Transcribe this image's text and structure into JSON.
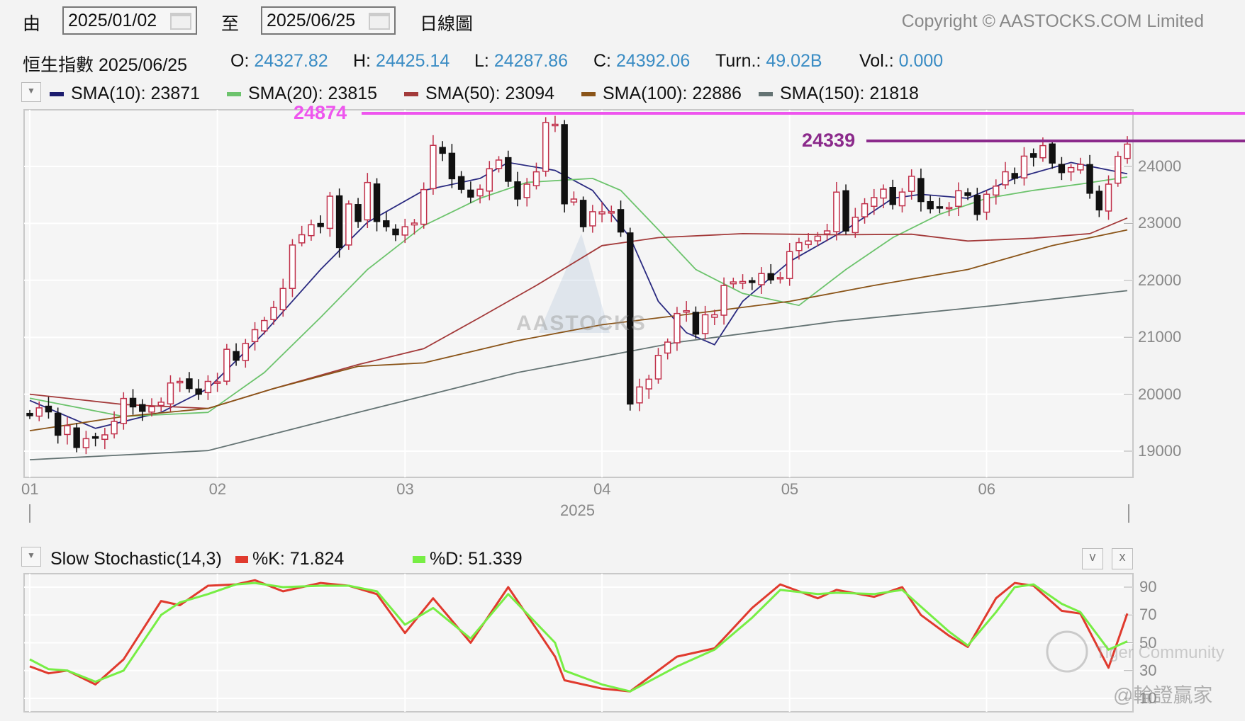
{
  "toolbar": {
    "from_label": "由",
    "from_date": "2025/01/02",
    "to_label": "至",
    "to_date": "2025/06/25",
    "period": "日線圖",
    "copyright": "Copyright © AASTOCKS.COM Limited"
  },
  "quote": {
    "name": "恒生指數",
    "date": "2025/06/25",
    "open_label": "O:",
    "open": "24327.82",
    "high_label": "H:",
    "high": "24425.14",
    "low_label": "L:",
    "low": "24287.86",
    "close_label": "C:",
    "close": "24392.06",
    "turn_label": "Turn.:",
    "turn": "49.02B",
    "vol_label": "Vol.:",
    "vol": "0.000"
  },
  "legend": [
    {
      "label": "SMA(10): 23871",
      "color": "#1c1c6e"
    },
    {
      "label": "SMA(20): 23815",
      "color": "#6cc36c"
    },
    {
      "label": "SMA(50): 23094",
      "color": "#a33a3a"
    },
    {
      "label": "SMA(100): 22886",
      "color": "#8a5418"
    },
    {
      "label": "SMA(150): 21818",
      "color": "#647373"
    }
  ],
  "stoch": {
    "title": "Slow Stochastic(14,3)",
    "k_label": "%K: 71.824",
    "d_label": "%D: 51.339",
    "k_color": "#e03a2e",
    "d_color": "#77ee44",
    "collapse_btn": "v",
    "close_btn": "x"
  },
  "watermarks": {
    "center": "AASTOCKS",
    "tiger": "Tiger Community",
    "handle": "@輪證贏家"
  },
  "chart_data": [
    {
      "type": "candlestick",
      "title": "恒生指數 日線圖",
      "ylim": [
        18700,
        24900
      ],
      "yticks": [
        19000,
        20000,
        21000,
        22000,
        23000,
        24000
      ],
      "xticks": [
        {
          "label": "01",
          "index": 0
        },
        {
          "label": "02",
          "index": 20
        },
        {
          "label": "03",
          "index": 40
        },
        {
          "label": "04",
          "index": 61
        },
        {
          "label": "05",
          "index": 81
        },
        {
          "label": "06",
          "index": 102
        }
      ],
      "xlabel": "2025",
      "hlines": [
        {
          "label": "24874",
          "value": 24874,
          "color": "#ee55ee"
        },
        {
          "label": "24339",
          "value": 24339,
          "color": "#8b2a8b"
        }
      ],
      "close": [
        19623,
        19760,
        19690,
        19280,
        19447,
        19065,
        19219,
        19227,
        19286,
        19522,
        19925,
        19778,
        19700,
        19780,
        19860,
        20197,
        20225,
        20100,
        20000,
        20225,
        20217,
        20789,
        20597,
        20891,
        21133,
        21294,
        21521,
        21857,
        22620,
        22800,
        22976,
        22944,
        23477,
        22577,
        23341,
        23035,
        23718,
        23034,
        22941,
        22800,
        22941,
        23006,
        23594,
        24370,
        24231,
        23784,
        23600,
        23462,
        23600,
        23959,
        24112,
        23740,
        23428,
        23689,
        23905,
        24771,
        24740,
        23344,
        23427,
        22941,
        23205,
        23202,
        23206,
        22849,
        19828,
        20127,
        20264,
        20682,
        20915,
        21417,
        21466,
        21056,
        21395,
        21395,
        21909,
        21972,
        21980,
        21962,
        22119,
        22008,
        22050,
        22504,
        22662,
        22691,
        22775,
        22868,
        23549,
        22867,
        23108,
        23345,
        23453,
        23601,
        23333,
        23550,
        23827,
        23384,
        23258,
        23289,
        23282,
        23573,
        23490,
        23158,
        23512,
        23654,
        23906,
        23792,
        24181,
        24162,
        24366,
        24060,
        23892,
        23980,
        24036,
        23530,
        23237,
        23689,
        24177,
        24392
      ],
      "sma": [
        {
          "name": "SMA(10)",
          "color": "#2a2a80",
          "points": [
            [
              0,
              19890
            ],
            [
              7,
              19400
            ],
            [
              14,
              19680
            ],
            [
              19,
              20100
            ],
            [
              25,
              21080
            ],
            [
              31,
              22190
            ],
            [
              36,
              23020
            ],
            [
              42,
              23580
            ],
            [
              48,
              23790
            ],
            [
              51,
              24070
            ],
            [
              56,
              23930
            ],
            [
              60,
              23580
            ],
            [
              64,
              22750
            ],
            [
              67,
              21630
            ],
            [
              70,
              21080
            ],
            [
              73,
              20870
            ],
            [
              76,
              21630
            ],
            [
              81,
              22330
            ],
            [
              87,
              22890
            ],
            [
              92,
              23440
            ],
            [
              95,
              23510
            ],
            [
              100,
              23440
            ],
            [
              105,
              23790
            ],
            [
              111,
              24070
            ],
            [
              117,
              23871
            ]
          ]
        },
        {
          "name": "SMA(20)",
          "color": "#6cc36c",
          "points": [
            [
              0,
              19930
            ],
            [
              10,
              19610
            ],
            [
              19,
              19680
            ],
            [
              25,
              20380
            ],
            [
              31,
              21350
            ],
            [
              36,
              22190
            ],
            [
              42,
              22960
            ],
            [
              48,
              23440
            ],
            [
              53,
              23720
            ],
            [
              60,
              23790
            ],
            [
              63,
              23580
            ],
            [
              67,
              22890
            ],
            [
              71,
              22190
            ],
            [
              76,
              21770
            ],
            [
              82,
              21560
            ],
            [
              87,
              22190
            ],
            [
              92,
              22750
            ],
            [
              97,
              23160
            ],
            [
              102,
              23440
            ],
            [
              107,
              23580
            ],
            [
              112,
              23690
            ],
            [
              117,
              23815
            ]
          ]
        },
        {
          "name": "SMA(50)",
          "color": "#a33a3a",
          "points": [
            [
              0,
              20000
            ],
            [
              10,
              19820
            ],
            [
              19,
              19750
            ],
            [
              26,
              20100
            ],
            [
              35,
              20520
            ],
            [
              42,
              20800
            ],
            [
              48,
              21350
            ],
            [
              54,
              21910
            ],
            [
              61,
              22610
            ],
            [
              67,
              22750
            ],
            [
              76,
              22820
            ],
            [
              86,
              22800
            ],
            [
              94,
              22810
            ],
            [
              100,
              22690
            ],
            [
              107,
              22740
            ],
            [
              113,
              22820
            ],
            [
              117,
              23094
            ]
          ]
        },
        {
          "name": "SMA(100)",
          "color": "#8a5418",
          "points": [
            [
              0,
              19360
            ],
            [
              10,
              19610
            ],
            [
              19,
              19750
            ],
            [
              26,
              20100
            ],
            [
              35,
              20490
            ],
            [
              42,
              20550
            ],
            [
              52,
              20940
            ],
            [
              61,
              21220
            ],
            [
              71,
              21420
            ],
            [
              81,
              21630
            ],
            [
              90,
              21910
            ],
            [
              100,
              22190
            ],
            [
              109,
              22610
            ],
            [
              117,
              22886
            ]
          ]
        },
        {
          "name": "SMA(150)",
          "color": "#647373",
          "points": [
            [
              0,
              18850
            ],
            [
              19,
              19010
            ],
            [
              35,
              19680
            ],
            [
              52,
              20380
            ],
            [
              69,
              20910
            ],
            [
              86,
              21280
            ],
            [
              103,
              21560
            ],
            [
              117,
              21818
            ]
          ]
        }
      ]
    },
    {
      "type": "line",
      "title": "Slow Stochastic(14,3)",
      "ylim": [
        0,
        100
      ],
      "yticks": [
        10,
        30,
        50,
        70,
        90
      ],
      "series": [
        {
          "name": "%K",
          "color": "#e03a2e",
          "points": [
            [
              0,
              33
            ],
            [
              2,
              28
            ],
            [
              4,
              30
            ],
            [
              7,
              20
            ],
            [
              10,
              38
            ],
            [
              14,
              80
            ],
            [
              16,
              77
            ],
            [
              19,
              91
            ],
            [
              22,
              92
            ],
            [
              24,
              95
            ],
            [
              27,
              87
            ],
            [
              31,
              93
            ],
            [
              34,
              91
            ],
            [
              37,
              85
            ],
            [
              40,
              57
            ],
            [
              43,
              82
            ],
            [
              47,
              50
            ],
            [
              51,
              90
            ],
            [
              56,
              40
            ],
            [
              57,
              23
            ],
            [
              61,
              17
            ],
            [
              64,
              15
            ],
            [
              69,
              40
            ],
            [
              73,
              46
            ],
            [
              77,
              75
            ],
            [
              80,
              92
            ],
            [
              84,
              82
            ],
            [
              86,
              88
            ],
            [
              90,
              83
            ],
            [
              93,
              90
            ],
            [
              95,
              70
            ],
            [
              98,
              55
            ],
            [
              100,
              47
            ],
            [
              103,
              82
            ],
            [
              105,
              93
            ],
            [
              107,
              91
            ],
            [
              110,
              73
            ],
            [
              112,
              71
            ],
            [
              115,
              32
            ],
            [
              117,
              71
            ]
          ]
        },
        {
          "name": "%D",
          "color": "#77ee44",
          "points": [
            [
              0,
              38
            ],
            [
              2,
              31
            ],
            [
              4,
              30
            ],
            [
              7,
              22
            ],
            [
              10,
              30
            ],
            [
              14,
              70
            ],
            [
              16,
              79
            ],
            [
              19,
              85
            ],
            [
              22,
              92
            ],
            [
              24,
              93
            ],
            [
              27,
              90
            ],
            [
              31,
              91
            ],
            [
              34,
              91
            ],
            [
              37,
              87
            ],
            [
              40,
              63
            ],
            [
              43,
              75
            ],
            [
              47,
              53
            ],
            [
              51,
              85
            ],
            [
              56,
              50
            ],
            [
              57,
              30
            ],
            [
              61,
              20
            ],
            [
              64,
              15
            ],
            [
              69,
              33
            ],
            [
              73,
              45
            ],
            [
              77,
              68
            ],
            [
              80,
              88
            ],
            [
              84,
              85
            ],
            [
              86,
              86
            ],
            [
              90,
              85
            ],
            [
              93,
              88
            ],
            [
              95,
              76
            ],
            [
              98,
              58
            ],
            [
              100,
              48
            ],
            [
              103,
              72
            ],
            [
              105,
              90
            ],
            [
              107,
              92
            ],
            [
              110,
              78
            ],
            [
              112,
              72
            ],
            [
              115,
              45
            ],
            [
              117,
              51
            ]
          ]
        }
      ]
    }
  ]
}
